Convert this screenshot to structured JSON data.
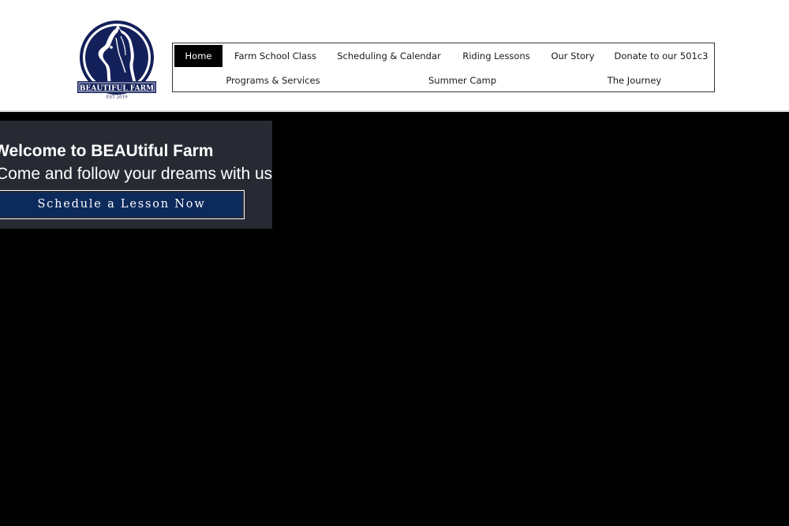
{
  "logo": {
    "name": "BEAUTIFUL FARM",
    "established": "EST 2019",
    "icon": "horse-head-icon",
    "color": "#14205a"
  },
  "nav": {
    "items": [
      {
        "label": "Home",
        "active": true
      },
      {
        "label": "Farm School Class"
      },
      {
        "label": "Scheduling & Calendar"
      },
      {
        "label": "Riding Lessons"
      },
      {
        "label": "Our Story"
      },
      {
        "label": "Donate to our 501c3"
      },
      {
        "label": "Programs & Services"
      },
      {
        "label": "Summer Camp"
      },
      {
        "label": "The Journey"
      }
    ]
  },
  "hero": {
    "title": "Welcome to BEAUtiful Farm",
    "subtitle": "Come and follow your dreams with us",
    "cta_label": "Schedule a Lesson Now",
    "cta_color": "#0d2a5c",
    "box_color": "#272a33"
  }
}
